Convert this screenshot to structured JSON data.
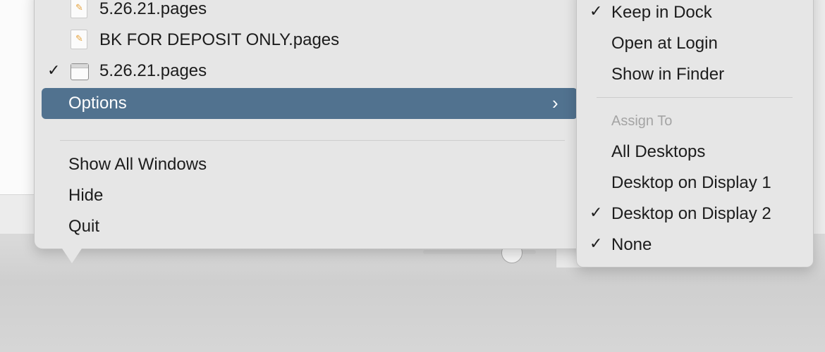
{
  "dock_menu": {
    "documents": [
      {
        "label": "5.26.21.pages",
        "checked": false,
        "icon": "pages-document-icon"
      },
      {
        "label": "BK FOR DEPOSIT ONLY.pages",
        "checked": false,
        "icon": "pages-document-icon"
      },
      {
        "label": "5.26.21.pages",
        "checked": true,
        "icon": "window-icon"
      }
    ],
    "options_label": "Options",
    "options_chevron": "chevron-right-icon",
    "show_all_windows": "Show All Windows",
    "hide": "Hide",
    "quit": "Quit"
  },
  "options_submenu": {
    "keep_in_dock": "Keep in Dock",
    "keep_in_dock_checked": true,
    "open_at_login": "Open at Login",
    "show_in_finder": "Show in Finder",
    "assign_to_header": "Assign To",
    "assign_options": [
      {
        "label": "All Desktops",
        "checked": false
      },
      {
        "label": "Desktop on Display 1",
        "checked": false
      },
      {
        "label": "Desktop on Display 2",
        "checked": true
      },
      {
        "label": "None",
        "checked": true
      }
    ]
  },
  "check_glyph": "✓",
  "colors": {
    "highlight": "#51728f",
    "menu_background": "#e6e6e6"
  }
}
